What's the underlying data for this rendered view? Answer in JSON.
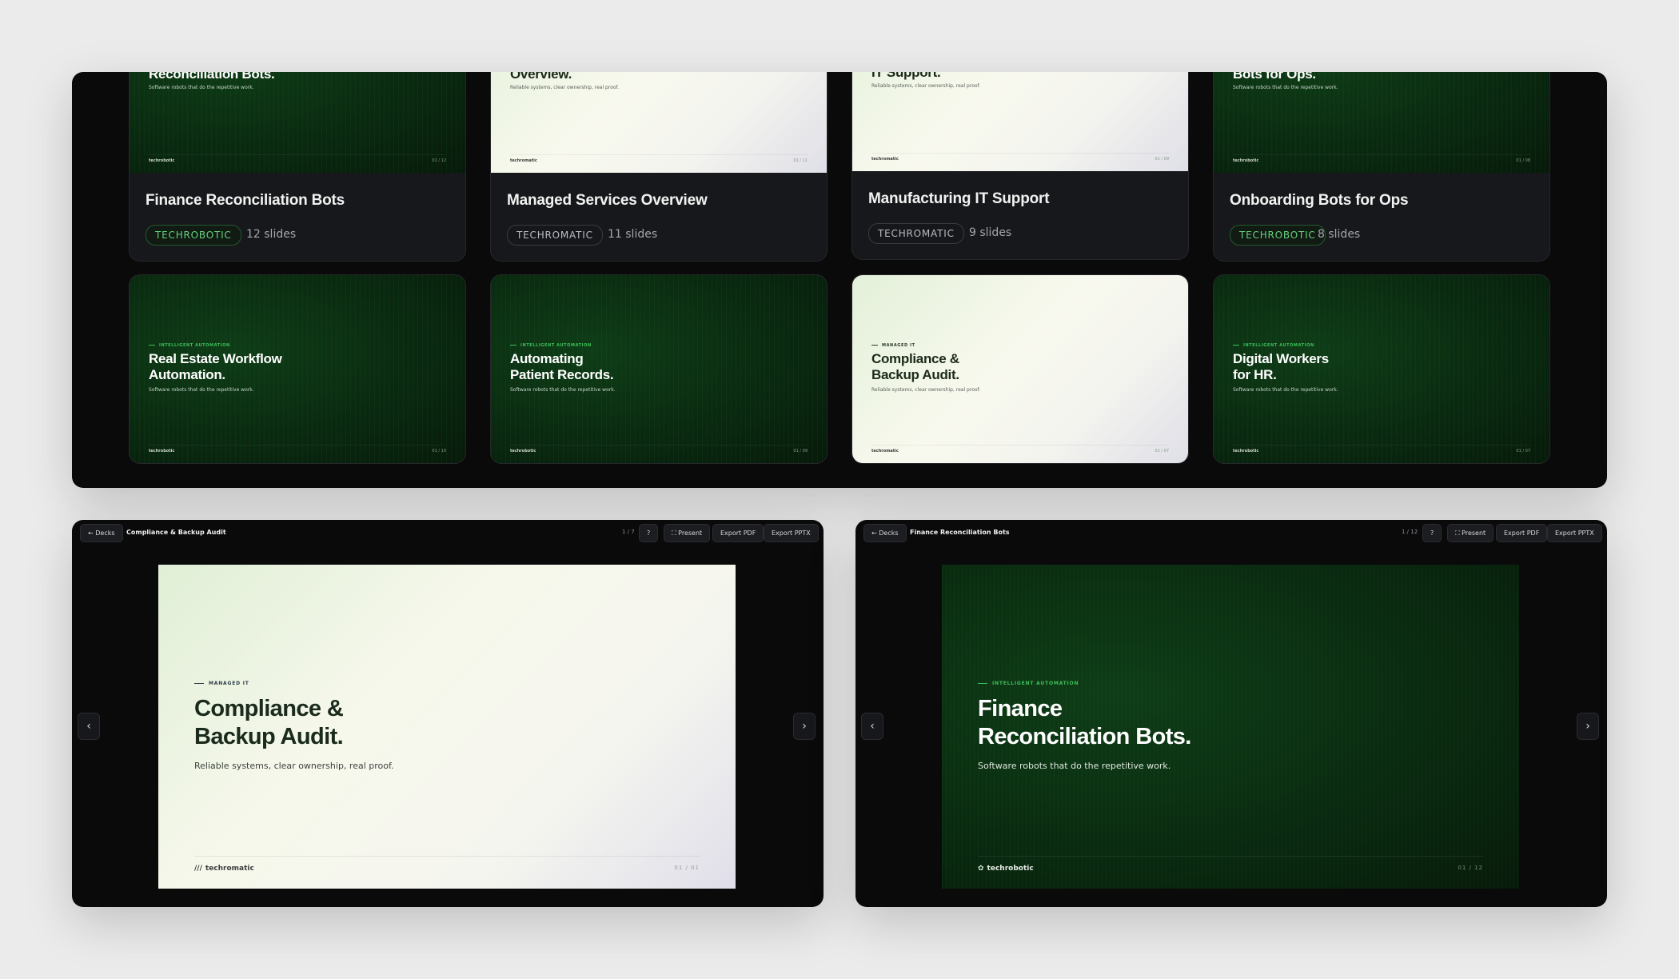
{
  "gallery": {
    "row1": [
      {
        "thumb_title": "Reconciliation Bots.",
        "thumb_sub": "Software robots that do the repetitive work.",
        "thumb_logo": "techrobotic",
        "thumb_page": "01 / 12",
        "title": "Finance Reconciliation Bots",
        "badge": "TECHROBOTIC",
        "slides": "12 slides",
        "theme": "dark"
      },
      {
        "thumb_title": "Overview.",
        "thumb_sub": "Reliable systems, clear ownership, real proof.",
        "thumb_logo": "techromatic",
        "thumb_page": "01 / 11",
        "title": "Managed Services Overview",
        "badge": "TECHROMATIC",
        "slides": "11 slides",
        "theme": "light"
      },
      {
        "thumb_title": "IT Support.",
        "thumb_sub": "Reliable systems, clear ownership, real proof.",
        "thumb_logo": "techromatic",
        "thumb_page": "01 / 09",
        "title": "Manufacturing IT Support",
        "badge": "TECHROMATIC",
        "slides": "9 slides",
        "theme": "light"
      },
      {
        "thumb_title": "Bots for Ops.",
        "thumb_sub": "Software robots that do the repetitive work.",
        "thumb_logo": "techrobotic",
        "thumb_page": "01 / 08",
        "title": "Onboarding Bots for Ops",
        "badge": "TECHROBOTIC",
        "slides": "8 slides",
        "theme": "dark"
      }
    ],
    "row2": [
      {
        "kicker": "INTELLIGENT AUTOMATION",
        "thumb_title": "Real Estate Workflow Automation.",
        "thumb_sub": "Software robots that do the repetitive work.",
        "thumb_logo": "techrobotic",
        "thumb_page": "01 / 10",
        "theme": "dark"
      },
      {
        "kicker": "INTELLIGENT AUTOMATION",
        "thumb_title": "Automating Patient Records.",
        "thumb_sub": "Software robots that do the repetitive work.",
        "thumb_logo": "techrobotic",
        "thumb_page": "01 / 09",
        "theme": "dark"
      },
      {
        "kicker": "MANAGED IT",
        "thumb_title": "Compliance & Backup Audit.",
        "thumb_sub": "Reliable systems, clear ownership, real proof.",
        "thumb_logo": "techromatic",
        "thumb_page": "01 / 07",
        "theme": "light"
      },
      {
        "kicker": "INTELLIGENT AUTOMATION",
        "thumb_title": "Digital Workers for HR.",
        "thumb_sub": "Software robots that do the repetitive work.",
        "thumb_logo": "techrobotic",
        "thumb_page": "01 / 07",
        "theme": "dark"
      }
    ]
  },
  "viewer_left": {
    "back": "← Decks",
    "title": "Compliance & Backup Audit",
    "counter": "1 / 7",
    "help": "?",
    "present": "⛶ Present",
    "export_pdf": "Export PDF",
    "export_pptx": "Export PPTX",
    "prev": "‹",
    "next": "›",
    "slide": {
      "kicker": "MANAGED IT",
      "title_line1": "Compliance &",
      "title_line2": "Backup Audit.",
      "subtitle": "Reliable systems, clear ownership, real proof.",
      "logo_mark": "///",
      "logo": "techromatic",
      "page": "01 / 01"
    }
  },
  "viewer_right": {
    "back": "← Decks",
    "title": "Finance Reconciliation Bots",
    "counter": "1 / 12",
    "help": "?",
    "present": "⛶ Present",
    "export_pdf": "Export PDF",
    "export_pptx": "Export PPTX",
    "prev": "‹",
    "next": "›",
    "slide": {
      "kicker": "INTELLIGENT AUTOMATION",
      "title_line1": "Finance",
      "title_line2": "Reconciliation Bots.",
      "subtitle": "Software robots that do the repetitive work.",
      "logo_mark": "✿",
      "logo": "techrobotic",
      "page": "01 / 12"
    }
  },
  "colors": {
    "accent_green": "#3cc05a",
    "panel_bg": "#0a0a0b",
    "card_bg": "#17181b",
    "page_bg": "#ebebec"
  }
}
